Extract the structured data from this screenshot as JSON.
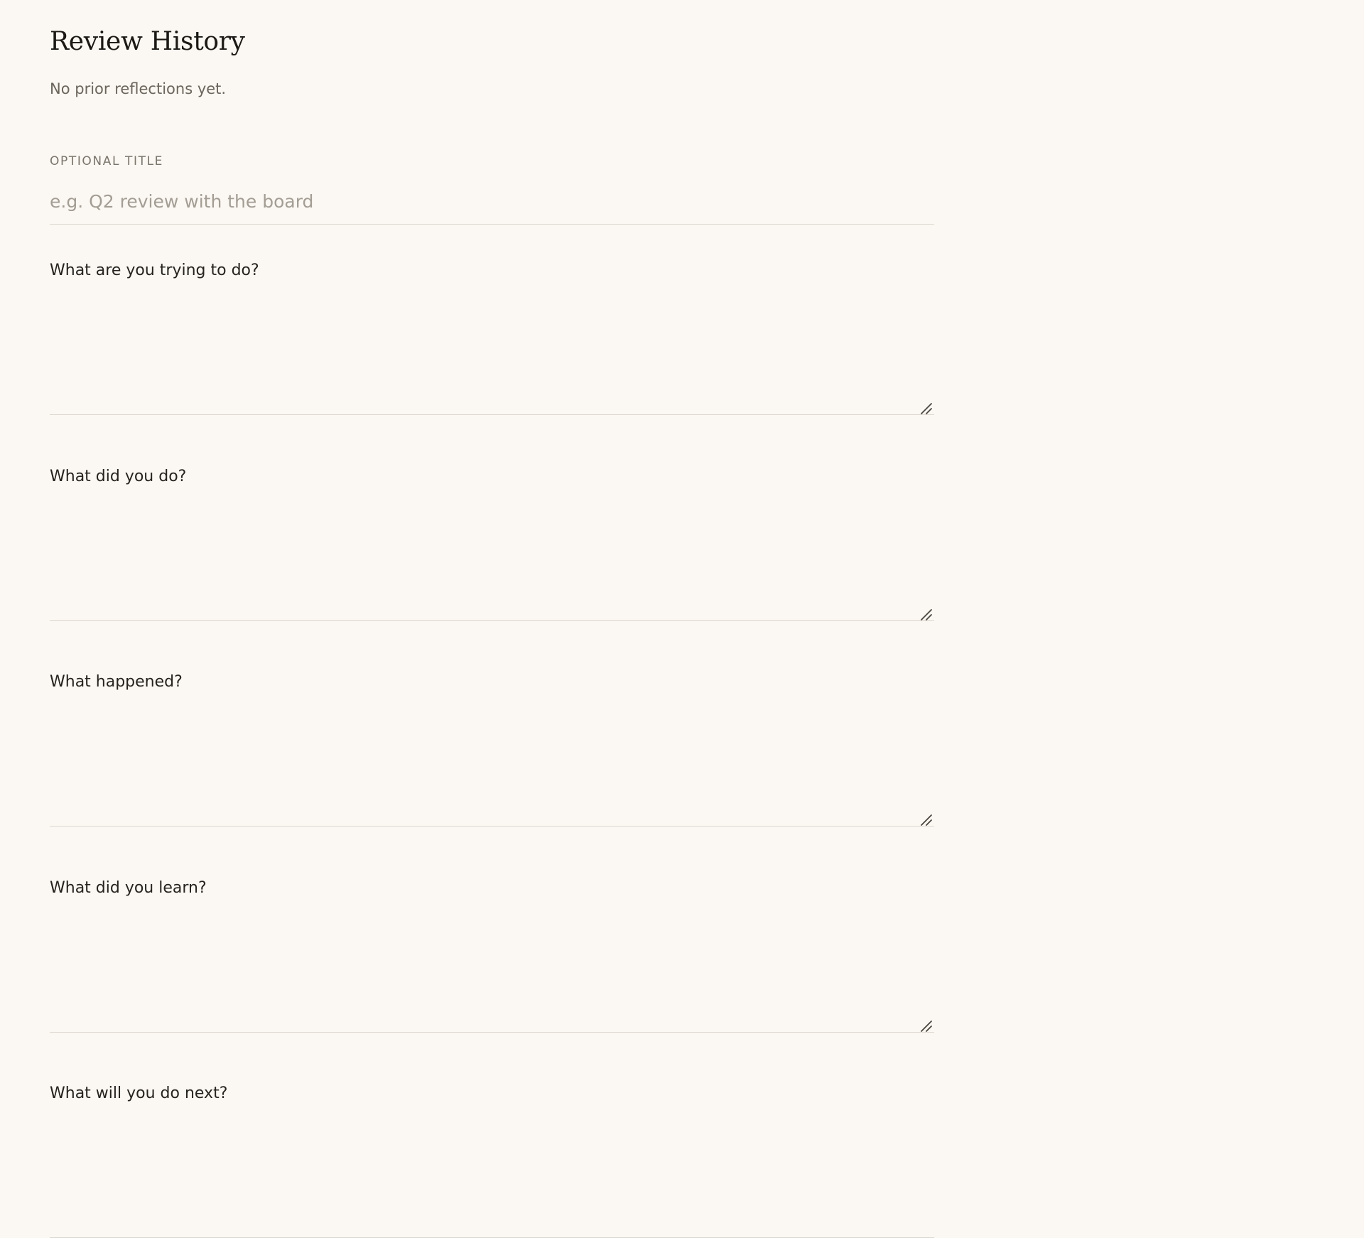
{
  "review_history": {
    "title": "Review History",
    "empty_message": "No prior reflections yet."
  },
  "form": {
    "title_field": {
      "label": "OPTIONAL TITLE",
      "placeholder": "e.g. Q2 review with the board",
      "value": ""
    },
    "questions": [
      {
        "label": "What are you trying to do?",
        "value": ""
      },
      {
        "label": "What did you do?",
        "value": ""
      },
      {
        "label": "What happened?",
        "value": ""
      },
      {
        "label": "What did you learn?",
        "value": ""
      },
      {
        "label": "What will you do next?",
        "value": ""
      }
    ]
  },
  "icons": {
    "textarea_resize": "resize-grip-icon"
  },
  "colors": {
    "background": "#fbf8f3",
    "text": "#1f1b16",
    "muted_text": "#6b655c",
    "placeholder": "#a39d94",
    "divider": "#dcd7ce"
  }
}
